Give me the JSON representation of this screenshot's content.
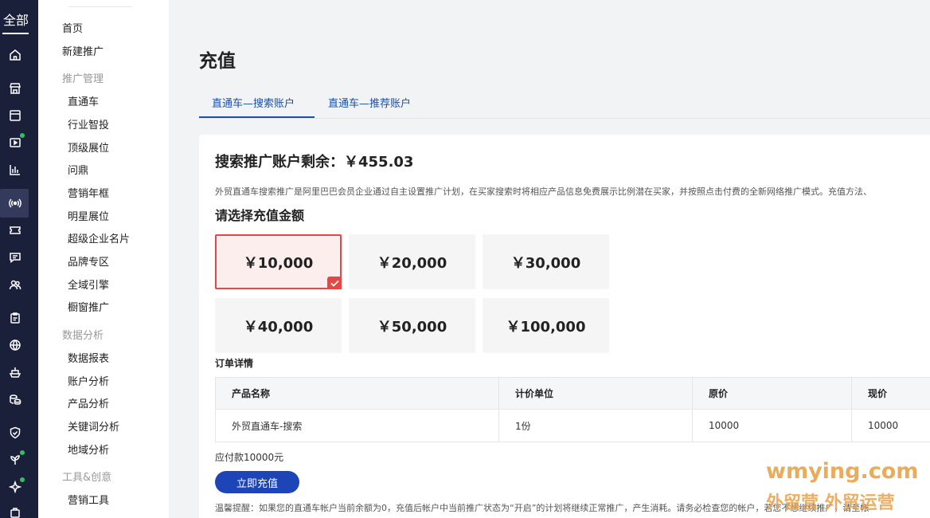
{
  "rail": {
    "all_label": "全部",
    "icons": [
      "home-icon",
      "store-icon",
      "box-icon",
      "video-icon",
      "bar-chart-icon",
      "broadcast-icon",
      "ticket-icon",
      "message-icon",
      "users-icon",
      "clipboard-icon",
      "globe-icon",
      "ship-icon",
      "coins-icon",
      "shield-icon",
      "sprout-icon",
      "sparkle-icon",
      "bag-icon"
    ]
  },
  "menu": {
    "home": "首页",
    "new_promo": "新建推广",
    "group_promo": "推广管理",
    "promo_items": [
      "直通车",
      "行业智投",
      "顶级展位",
      "问鼎",
      "营销年框",
      "明星展位",
      "超级企业名片",
      "品牌专区",
      "全域引擎",
      "橱窗推广"
    ],
    "group_data": "数据分析",
    "data_items": [
      "数据报表",
      "账户分析",
      "产品分析",
      "关键词分析",
      "地域分析"
    ],
    "group_tools": "工具&创意",
    "tools_items": [
      "营销工具"
    ]
  },
  "main": {
    "title": "充值",
    "tabs": [
      "直通车—搜索账户",
      "直通车—推荐账户"
    ],
    "balance": "搜索推广账户剩余：￥455.03",
    "description": "外贸直通车搜索推广是阿里巴巴会员企业通过自主设置推广计划，在买家搜索时将相应产品信息免费展示比例潜在买家，并按照点击付费的全新网络推广模式。充值方法、",
    "choose_label": "请选择充值金额",
    "amounts": [
      "￥10,000",
      "￥20,000",
      "￥30,000",
      "￥40,000",
      "￥50,000",
      "￥100,000"
    ],
    "selected_index": 0,
    "order_label": "订单详情",
    "table": {
      "headers": [
        "产品名称",
        "计价单位",
        "原价",
        "现价"
      ],
      "rows": [
        [
          "外贸直通车-搜索",
          "1份",
          "10000",
          "10000"
        ]
      ]
    },
    "payable": "应付款10000元",
    "recharge_button": "立即充值",
    "tip": "温馨提醒：如果您的直通车帐户当前余额为0，充值后帐户中当前推广状态为“开启”的计划将继续正常推广，产生消耗。请务必检查您的帐户，若您不想继续推广，请至帐"
  },
  "watermark": {
    "line1": "wmying.com",
    "line2": "外留营 外贸运营"
  },
  "colors": {
    "rail_bg": "#1a1f3a",
    "accent": "#1d45b8",
    "tab_blue": "#1d4fa5",
    "selected_red": "#e64646",
    "badge_green": "#2fc25b",
    "watermark": "#e8a24a"
  }
}
